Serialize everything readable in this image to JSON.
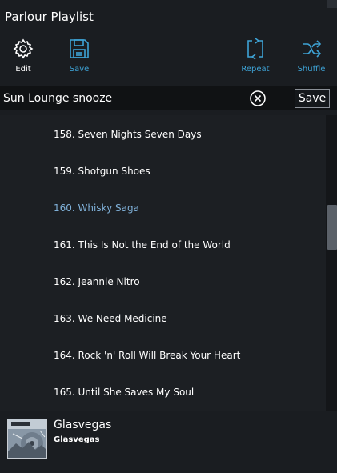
{
  "window": {
    "title": "Parlour Playlist"
  },
  "toolbar": {
    "edit_label": "Edit",
    "save_label": "Save",
    "repeat_label": "Repeat",
    "shuffle_label": "Shuffle"
  },
  "search": {
    "value": "Sun Lounge snooze",
    "save_label": "Save"
  },
  "tracks": [
    {
      "label": "158. Seven Nights Seven Days",
      "active": false
    },
    {
      "label": "159. Shotgun Shoes",
      "active": false
    },
    {
      "label": "160. Whisky Saga",
      "active": true
    },
    {
      "label": "161. This Is Not the End of the World",
      "active": false
    },
    {
      "label": "162. Jeannie Nitro",
      "active": false
    },
    {
      "label": "163. We Need Medicine",
      "active": false
    },
    {
      "label": "164. Rock 'n' Roll Will Break Your Heart",
      "active": false
    },
    {
      "label": "165. Until She Saves My Soul",
      "active": false
    }
  ],
  "now_playing": {
    "artist": "Glasvegas",
    "album": "Glasvegas"
  },
  "colors": {
    "accent": "#3ea3d6",
    "active_track": "#7fb0d8",
    "background": "#1a1d21"
  },
  "icons": [
    "gear-icon",
    "floppy-disk-icon",
    "repeat-icon",
    "shuffle-icon",
    "clear-circle-icon"
  ]
}
